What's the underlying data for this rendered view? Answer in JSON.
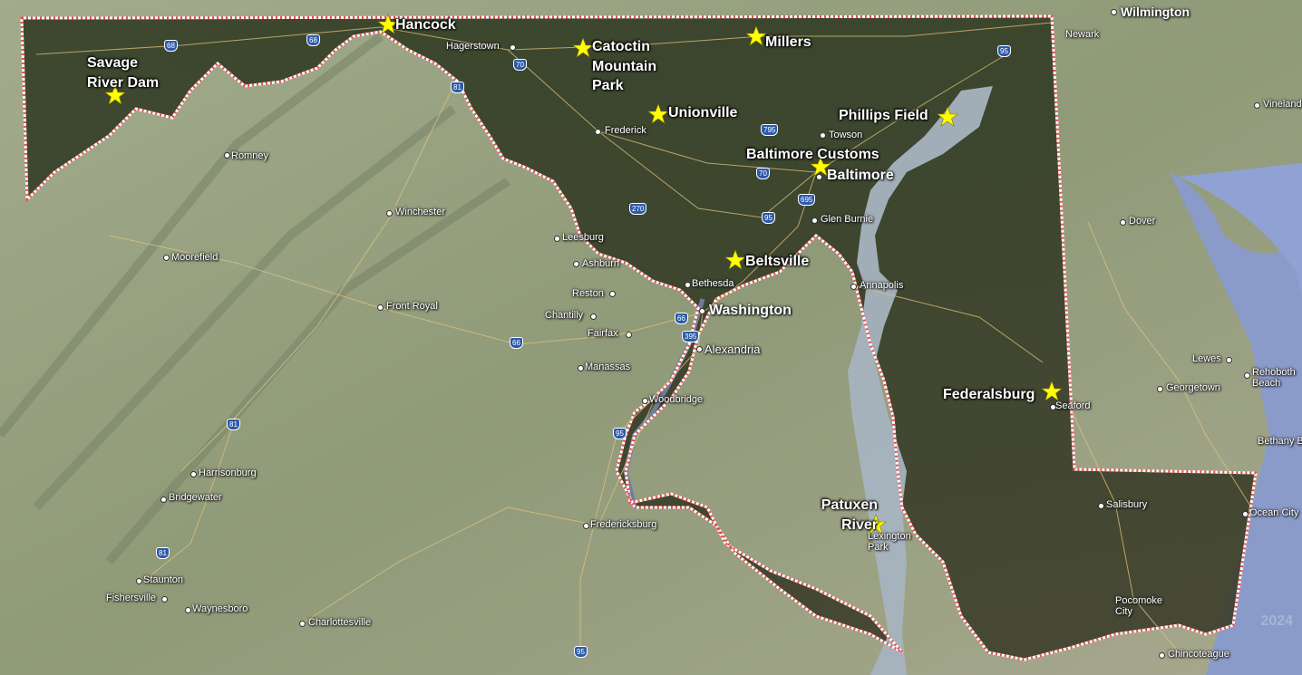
{
  "map": {
    "region": "Maryland",
    "border_color": "#ffffff",
    "border_dash_color": "#e05050",
    "star_color": "#ffff00",
    "watermark": "2024"
  },
  "markers": [
    {
      "label": "Hancock"
    },
    {
      "label": "Savage River Dam"
    },
    {
      "label": "Catoctin Mountain Park"
    },
    {
      "label": "Millers"
    },
    {
      "label": "Unionville"
    },
    {
      "label": "Phillips Field"
    },
    {
      "label": "Baltimore Customs"
    },
    {
      "label": "Beltsville"
    },
    {
      "label": "Federalsburg"
    },
    {
      "label": "Patuxen River"
    }
  ],
  "cities": [
    {
      "name": "Wilmington"
    },
    {
      "name": "Newark"
    },
    {
      "name": "Hagerstown"
    },
    {
      "name": "Frederick"
    },
    {
      "name": "Towson"
    },
    {
      "name": "Baltimore"
    },
    {
      "name": "Glen Burnie"
    },
    {
      "name": "Vineland"
    },
    {
      "name": "Dover"
    },
    {
      "name": "Romney"
    },
    {
      "name": "Winchester"
    },
    {
      "name": "Leesburg"
    },
    {
      "name": "Ashburn"
    },
    {
      "name": "Moorefield"
    },
    {
      "name": "Bethesda"
    },
    {
      "name": "Annapolis"
    },
    {
      "name": "Reston"
    },
    {
      "name": "Washington"
    },
    {
      "name": "Chantilly"
    },
    {
      "name": "Front Royal"
    },
    {
      "name": "Fairfax"
    },
    {
      "name": "Alexandria"
    },
    {
      "name": "Manassas"
    },
    {
      "name": "Lewes"
    },
    {
      "name": "Rehoboth Beach"
    },
    {
      "name": "Georgetown"
    },
    {
      "name": "Seaford"
    },
    {
      "name": "Woodbridge"
    },
    {
      "name": "Bethany Beach"
    },
    {
      "name": "Harrisonburg"
    },
    {
      "name": "Bridgewater"
    },
    {
      "name": "Salisbury"
    },
    {
      "name": "Fredericksburg"
    },
    {
      "name": "Ocean City"
    },
    {
      "name": "Lexington Park"
    },
    {
      "name": "Staunton"
    },
    {
      "name": "Fishersville"
    },
    {
      "name": "Waynesboro"
    },
    {
      "name": "Charlottesville"
    },
    {
      "name": "Pocomoke City"
    },
    {
      "name": "Chincoteague"
    }
  ],
  "highways": [
    "68",
    "68",
    "70",
    "81",
    "795",
    "70",
    "695",
    "270",
    "95",
    "95",
    "66",
    "395",
    "66",
    "81",
    "95",
    "81",
    "95"
  ]
}
